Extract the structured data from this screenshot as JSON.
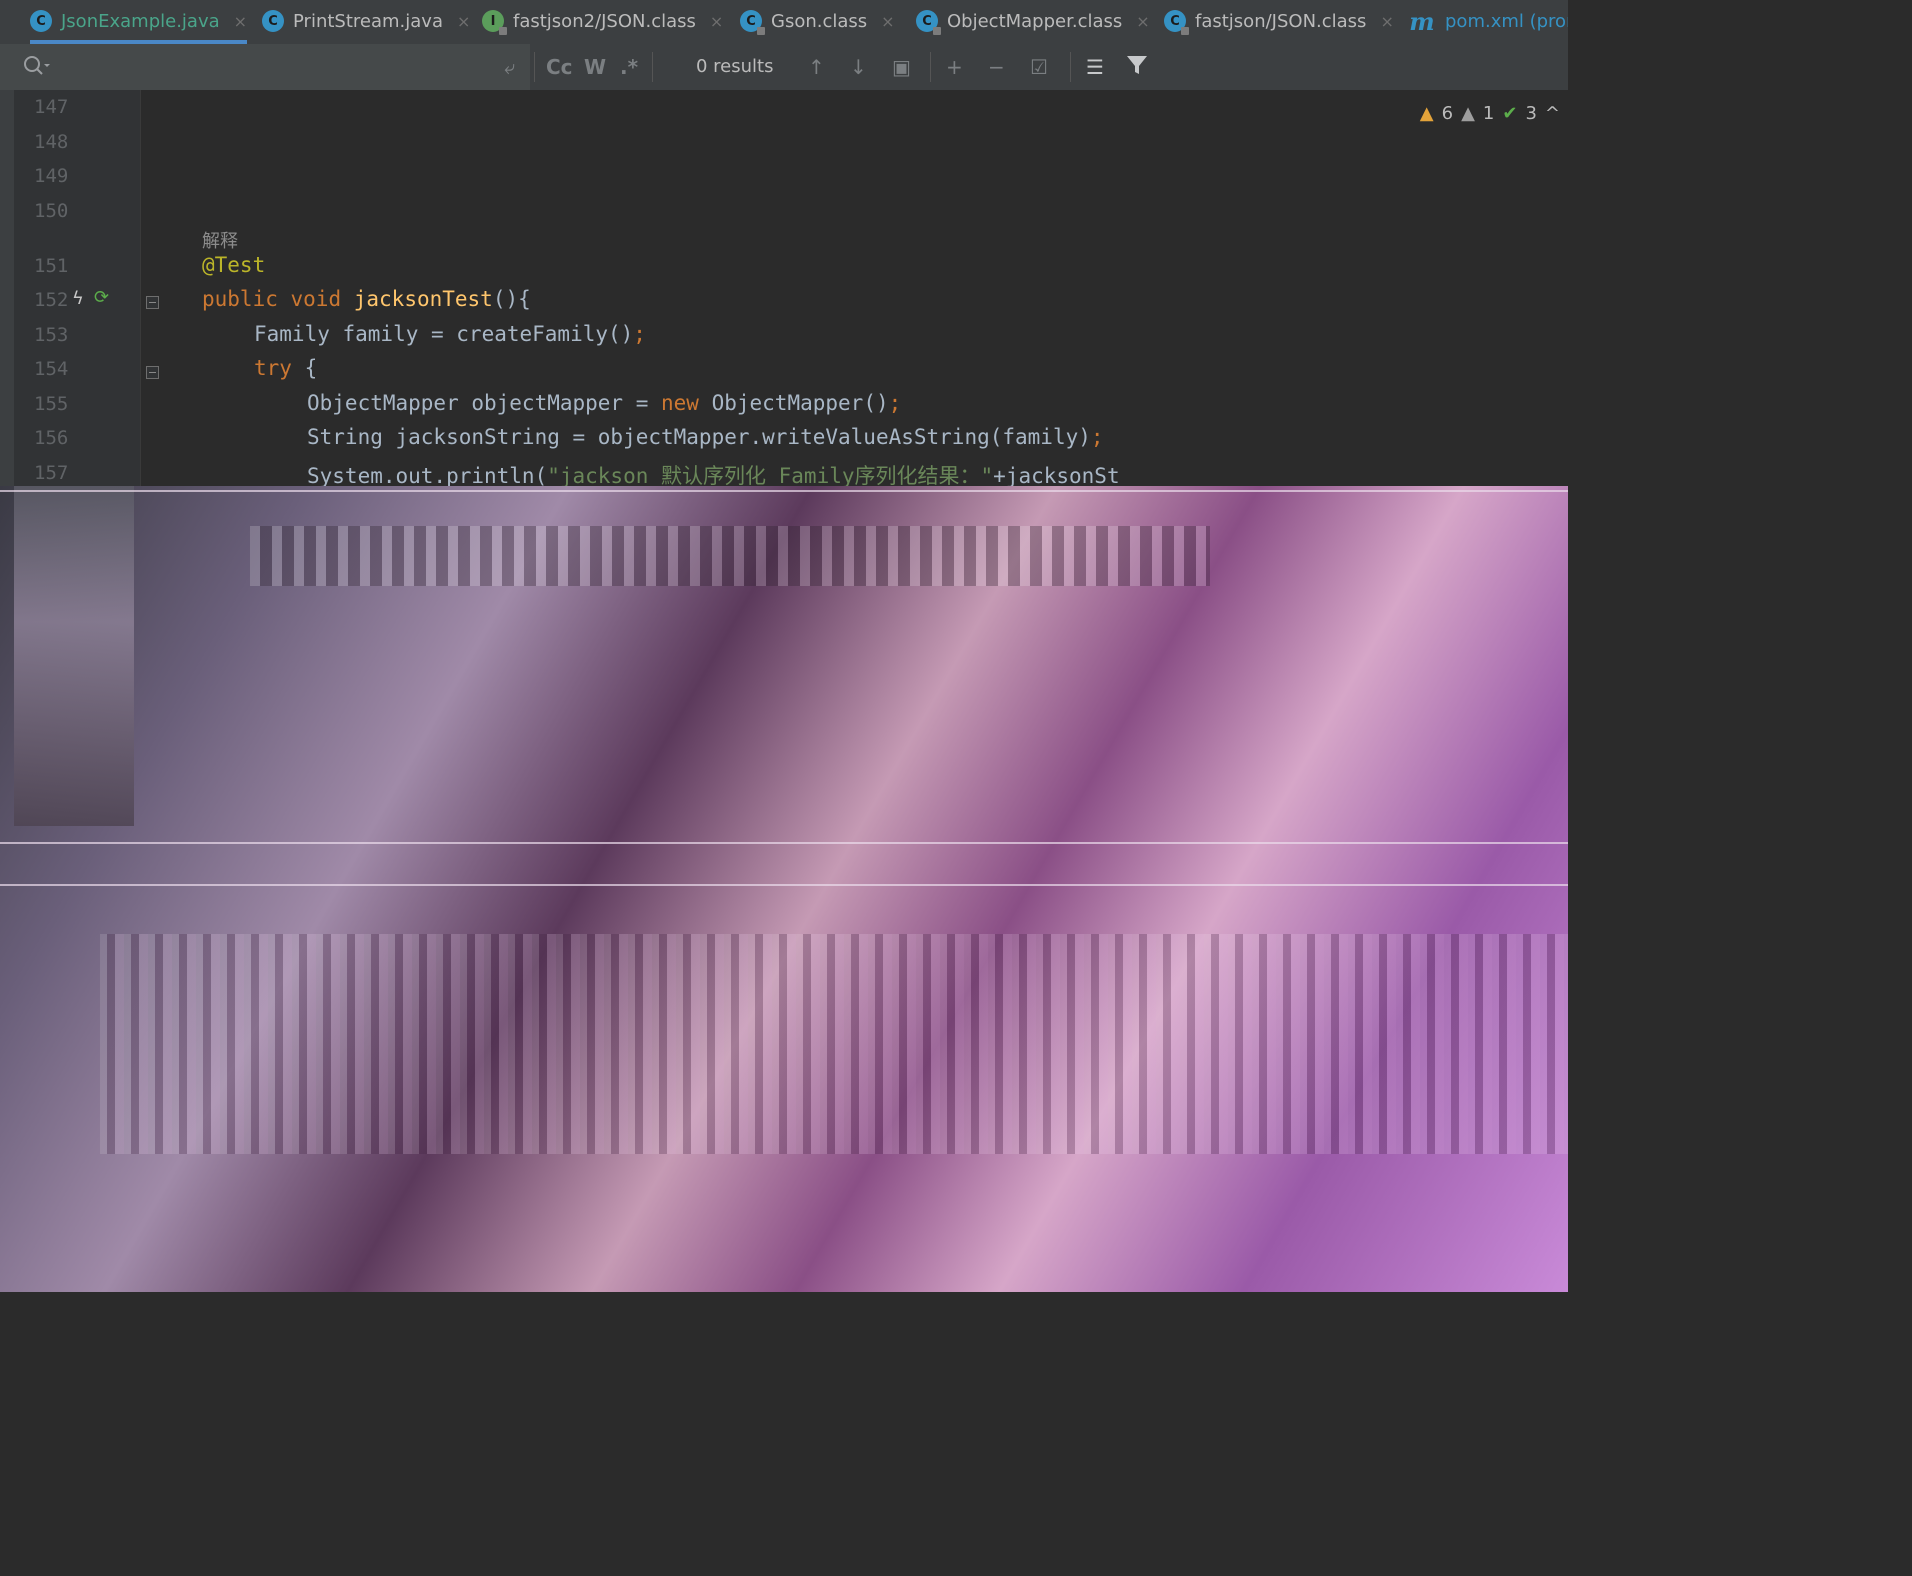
{
  "tabs": [
    {
      "label": "JsonExample.java",
      "icon": "class-icon",
      "icon_glyph": "C",
      "active": true
    },
    {
      "label": "PrintStream.java",
      "icon": "class-icon",
      "icon_glyph": "C",
      "active": false
    },
    {
      "label": "fastjson2/JSON.class",
      "icon": "interface-icon",
      "icon_glyph": "I",
      "active": false
    },
    {
      "label": "Gson.class",
      "icon": "library-class-icon",
      "icon_glyph": "C",
      "active": false
    },
    {
      "label": "ObjectMapper.class",
      "icon": "library-class-icon",
      "icon_glyph": "C",
      "active": false
    },
    {
      "label": "fastjson/JSON.class",
      "icon": "library-class-icon",
      "icon_glyph": "C",
      "active": false
    },
    {
      "label": "pom.xml (prom",
      "icon": "maven-icon",
      "icon_glyph": "m",
      "active": false
    }
  ],
  "tab_close_glyph": "×",
  "find": {
    "results": "0 results",
    "match_case_label": "Cc",
    "words_label": "W",
    "regex_label": ".*"
  },
  "inspections": {
    "warnings": "6",
    "weak_warnings": "1",
    "typos": "3"
  },
  "code_hint": "解释",
  "line_numbers": [
    "147",
    "148",
    "149",
    "150",
    "151",
    "152",
    "153",
    "154",
    "155",
    "156",
    "157"
  ],
  "code": {
    "l151_annotation": "@Test",
    "l152_kw_public": "public",
    "l152_kw_void": "void",
    "l152_method": "jacksonTest",
    "l152_rest": "(){",
    "l153_text": "Family family = createFamily()",
    "l153_semi": ";",
    "l154_kw_try": "try",
    "l154_rest": " {",
    "l155_a": "ObjectMapper objectMapper = ",
    "l155_kw_new": "new",
    "l155_b": " ObjectMapper()",
    "l155_semi": ";",
    "l156_a": "String jacksonString = objectMapper.writeValueAsString(family)",
    "l156_semi": ";",
    "l157_a": "System.out.println(",
    "l157_str": "\"jackson 默认序列化 Family序列化结果：\"",
    "l157_b": "+jacksonSt"
  },
  "colors": {
    "keyword": "#cc7832",
    "annotation": "#bbb529",
    "method": "#ffc66d",
    "string": "#6a8759",
    "active_tab_text": "#4aa58a",
    "background": "#2b2b2b"
  }
}
